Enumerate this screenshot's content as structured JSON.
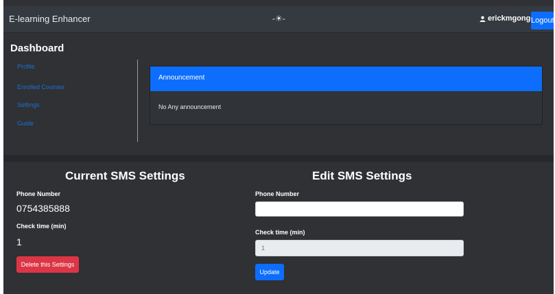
{
  "navbar": {
    "brand": "E-learning Enhancer",
    "center_icon": "sun-icon",
    "center_glyph": "-☀-",
    "user_icon": "user-icon",
    "username": "erickmgongo",
    "logout_label": "Logout"
  },
  "dashboard": {
    "title": "Dashboard",
    "links": [
      "Profile",
      "Enrolled Courses",
      "Settings",
      "Guide"
    ],
    "announcement": {
      "header": "Announcement",
      "body": "No Any announcement"
    }
  },
  "current_sms": {
    "title": "Current SMS Settings",
    "phone_label": "Phone Number",
    "phone_value": "0754385888",
    "time_label": "Check time (min)",
    "time_value": "1",
    "delete_label": "Delete this Settings"
  },
  "edit_sms": {
    "title": "Edit SMS Settings",
    "phone_label": "Phone Number",
    "phone_value": "",
    "time_label": "Check time (min)",
    "time_placeholder": "1",
    "update_label": "Update"
  },
  "colors": {
    "primary": "#0d6efd",
    "danger": "#dc3545",
    "background": "#2f3135",
    "navbar": "#353a40",
    "link": "#1f6fd6"
  }
}
